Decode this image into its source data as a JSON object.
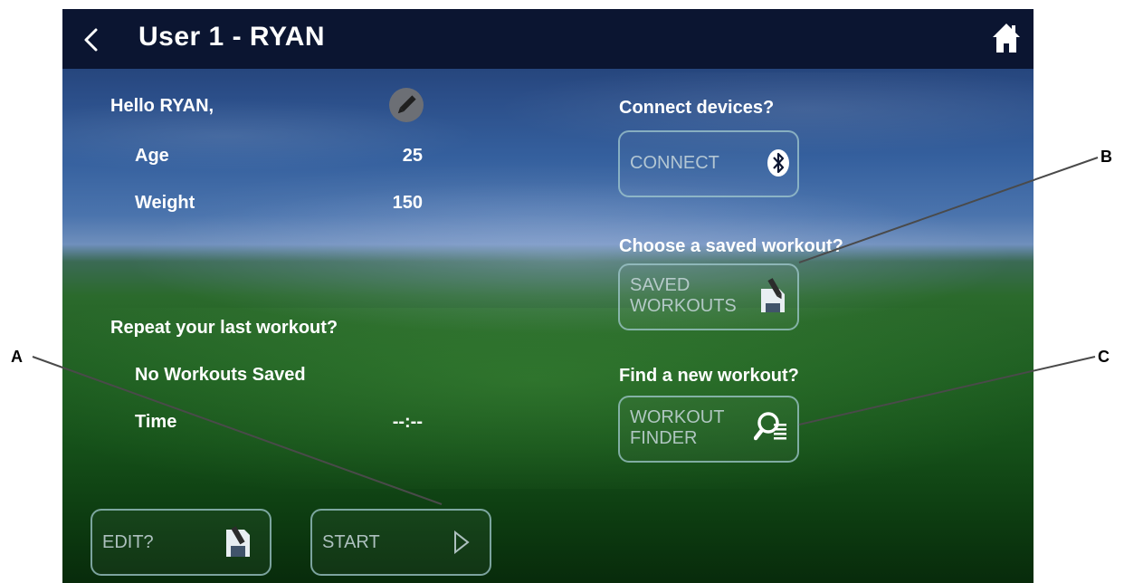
{
  "header": {
    "title": "User 1 - RYAN"
  },
  "profile": {
    "greeting": "Hello RYAN,",
    "age_label": "Age",
    "age_value": "25",
    "weight_label": "Weight",
    "weight_value": "150"
  },
  "last_workout": {
    "heading": "Repeat your last workout?",
    "status": "No Workouts Saved",
    "time_label": "Time",
    "time_value": "--:--"
  },
  "connect": {
    "heading": "Connect devices?",
    "button_label": "CONNECT"
  },
  "saved": {
    "heading": "Choose a saved workout?",
    "button_line1": "SAVED",
    "button_line2": "WORKOUTS"
  },
  "finder": {
    "heading": "Find a new workout?",
    "button_line1": "WORKOUT",
    "button_line2": "FINDER"
  },
  "actions": {
    "edit_label": "EDIT?",
    "start_label": "START"
  },
  "callouts": {
    "a": "A",
    "b": "B",
    "c": "C"
  },
  "icons": [
    "back-arrow-icon",
    "home-icon",
    "pencil-icon",
    "bluetooth-icon",
    "save-edit-icon",
    "search-list-icon",
    "play-arrow-icon"
  ],
  "colors": {
    "header_bg": "#0b1531",
    "button_border": "#a0c8cd",
    "text": "#ffffff"
  }
}
